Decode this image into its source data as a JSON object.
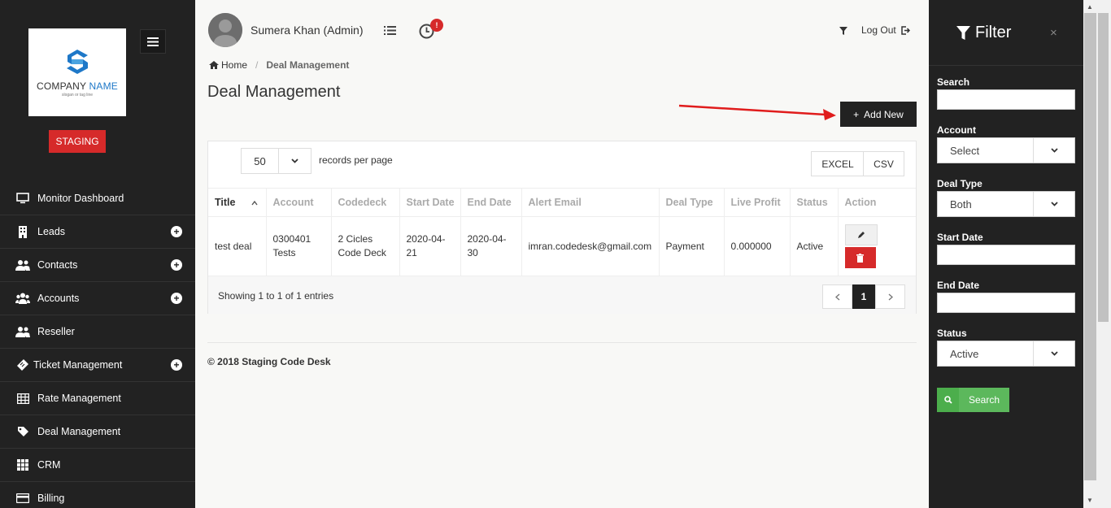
{
  "sidebar": {
    "logo_company": "COMPANY",
    "logo_name": "NAME",
    "logo_tagline": "slogan or tag line",
    "staging": "STAGING",
    "items": [
      {
        "label": "Monitor Dashboard",
        "icon": "monitor-icon",
        "plus": false
      },
      {
        "label": "Leads",
        "icon": "building-icon",
        "plus": true
      },
      {
        "label": "Contacts",
        "icon": "users-icon",
        "plus": true
      },
      {
        "label": "Accounts",
        "icon": "group-icon",
        "plus": true
      },
      {
        "label": "Reseller",
        "icon": "users-icon",
        "plus": false
      },
      {
        "label": "Ticket Management",
        "icon": "ticket-icon",
        "plus": true
      },
      {
        "label": "Rate Management",
        "icon": "table-icon",
        "plus": false
      },
      {
        "label": "Deal Management",
        "icon": "tag-icon",
        "plus": false
      },
      {
        "label": "CRM",
        "icon": "grid-icon",
        "plus": false
      },
      {
        "label": "Billing",
        "icon": "card-icon",
        "plus": false
      }
    ]
  },
  "header": {
    "username": "Sumera Khan (Admin)",
    "notif_badge": "!",
    "logout": "Log Out"
  },
  "breadcrumb": {
    "home": "Home",
    "sep": "/",
    "current": "Deal Management"
  },
  "page_title": "Deal Management",
  "add_new": "Add New",
  "table_controls": {
    "per_page": "50",
    "per_page_label": "records per page",
    "excel": "EXCEL",
    "csv": "CSV"
  },
  "table": {
    "columns": [
      "Title",
      "Account",
      "Codedeck",
      "Start Date",
      "End Date",
      "Alert Email",
      "Deal Type",
      "Live Profit",
      "Status",
      "Action"
    ],
    "rows": [
      {
        "title": "test deal",
        "account_1": "0300401",
        "account_2": "Tests",
        "codedeck_1": "2 Cicles",
        "codedeck_2": "Code Deck",
        "start_1": "2020-04-",
        "start_2": "21",
        "end_1": "2020-04-",
        "end_2": "30",
        "email": "imran.codedesk@gmail.com",
        "deal_type": "Payment",
        "live_profit": "0.000000",
        "status": "Active"
      }
    ],
    "showing": "Showing 1 to 1 of 1 entries",
    "page": "1"
  },
  "copyright": "© 2018 Staging Code Desk",
  "filter": {
    "title": "Filter",
    "close": "×",
    "search_label": "Search",
    "account_label": "Account",
    "account_value": "Select",
    "deal_type_label": "Deal Type",
    "deal_type_value": "Both",
    "start_date_label": "Start Date",
    "end_date_label": "End Date",
    "status_label": "Status",
    "status_value": "Active",
    "search_button": "Search"
  },
  "colors": {
    "sidebar": "#222222",
    "accent_red": "#d62a2a",
    "search_green": "#5cb85c"
  }
}
